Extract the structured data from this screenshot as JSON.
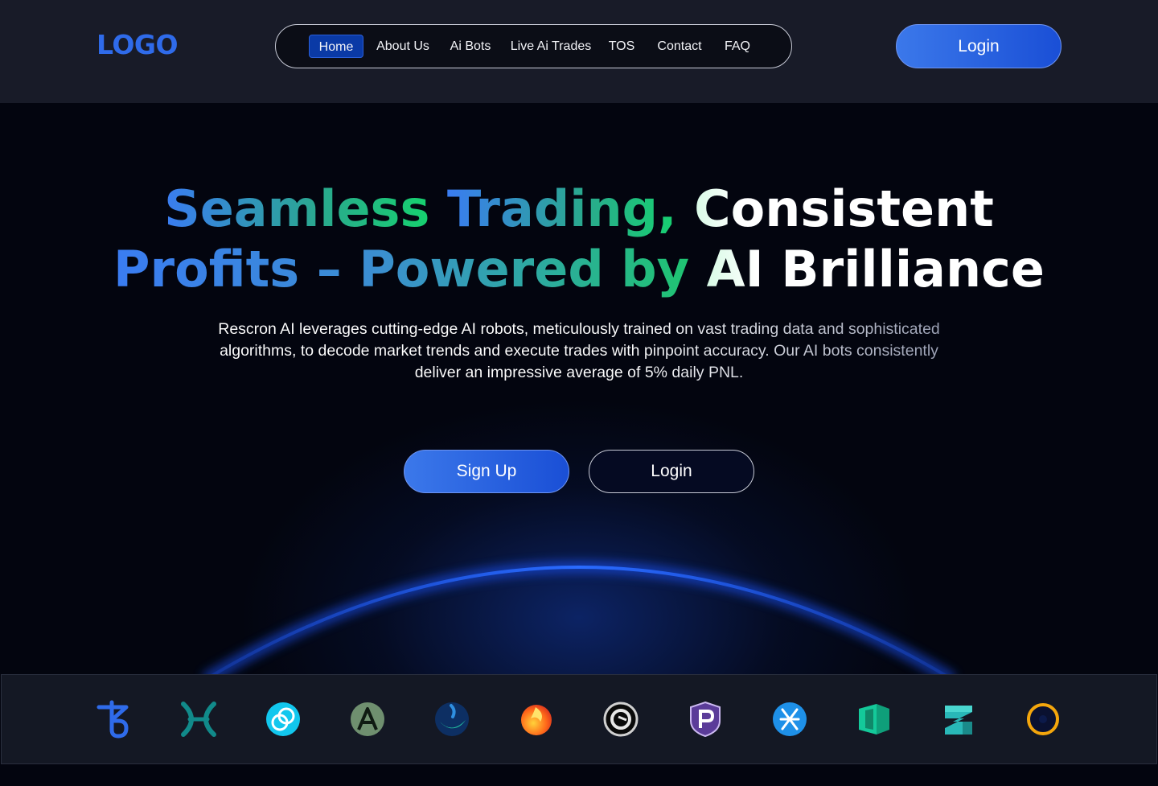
{
  "header": {
    "logo_text": "LOGO",
    "nav": [
      {
        "label": "Home",
        "active": true
      },
      {
        "label": "About Us"
      },
      {
        "label": "Ai Bots"
      },
      {
        "label": "Live Ai Trades"
      },
      {
        "label": "TOS"
      },
      {
        "label": "Contact"
      },
      {
        "label": "FAQ"
      }
    ],
    "login_label": "Login"
  },
  "hero": {
    "headline_line1_a": "Seamless ",
    "headline_line1_b": "Trading, ",
    "headline_line1_c": "Consistent",
    "headline_line2_a": "Profits – Powered by ",
    "headline_line2_b": "AI Brilliance",
    "subtext": "Rescron AI leverages cutting-edge AI robots, meticulously trained on vast trading data and sophisticated algorithms, to decode market trends and execute trades with pinpoint accuracy. Our AI bots consistently deliver an impressive average of 5% daily PNL.",
    "signup_label": "Sign Up",
    "login_label": "Login"
  },
  "crypto_logos": [
    "tezos-icon",
    "pisces-x-icon",
    "gemini-dollar-icon",
    "ark-icon",
    "crescent-icon",
    "fire-token-icon",
    "bittorrent-icon",
    "pivx-icon",
    "stellar-icon",
    "polymath-icon",
    "zilliqa-icon",
    "ring-coin-icon"
  ],
  "colors": {
    "accent": "#2f6bea",
    "header_bg": "#181b28",
    "page_bg": "#03050f",
    "green": "#13d86a"
  }
}
